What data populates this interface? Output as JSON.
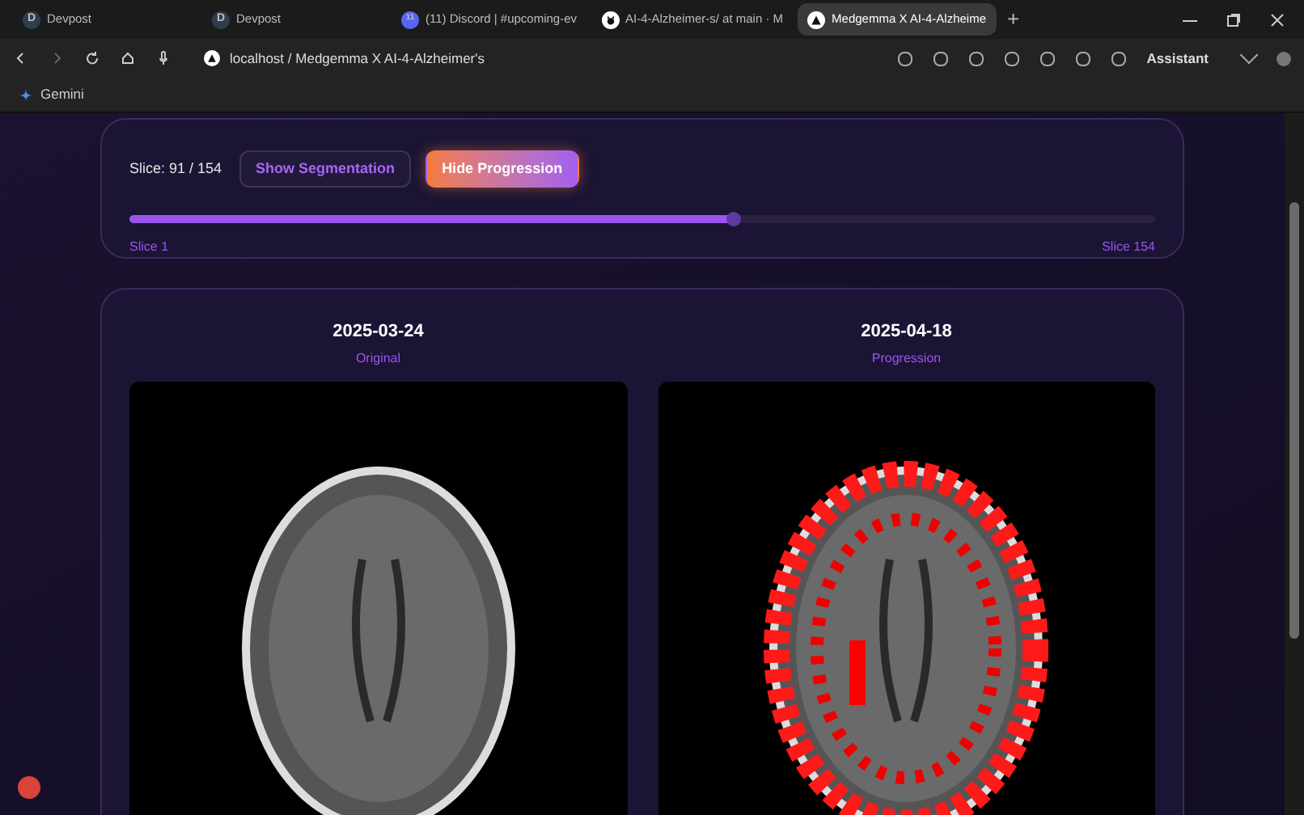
{
  "browser": {
    "tabs": [
      {
        "title": "Devpost",
        "kind": "letter",
        "icon_letter": "D",
        "selected": false
      },
      {
        "title": "Devpost",
        "kind": "letter",
        "icon_letter": "D",
        "selected": false
      },
      {
        "title": "(11) Discord | #upcoming-ev",
        "kind": "letter",
        "icon_letter": "11",
        "selected": false
      },
      {
        "title": "AI-4-Alzheimer-s/ at main · M",
        "kind": "github",
        "selected": false
      },
      {
        "title": "Medgemma X AI-4-Alzheime",
        "kind": "triangle",
        "selected": true
      }
    ],
    "new_tab": "+",
    "address": "localhost / Medgemma X AI-4-Alzheimer's",
    "assistant": "Assistant",
    "bookmarks": [
      "Gemini"
    ]
  },
  "controls": {
    "slice_label": "Slice: 91 / 154",
    "buttons": [
      {
        "label": "Show Segmentation",
        "selected": false
      },
      {
        "label": "Hide Progression",
        "selected": true
      }
    ],
    "slider": {
      "level": 0.588,
      "min_label": "Slice 1",
      "max_label": "Slice 154"
    }
  },
  "comparison": [
    {
      "date": "2025-03-24",
      "caption": "Original",
      "overlay": false
    },
    {
      "date": "2025-04-18",
      "caption": "Progression",
      "overlay": true
    }
  ]
}
